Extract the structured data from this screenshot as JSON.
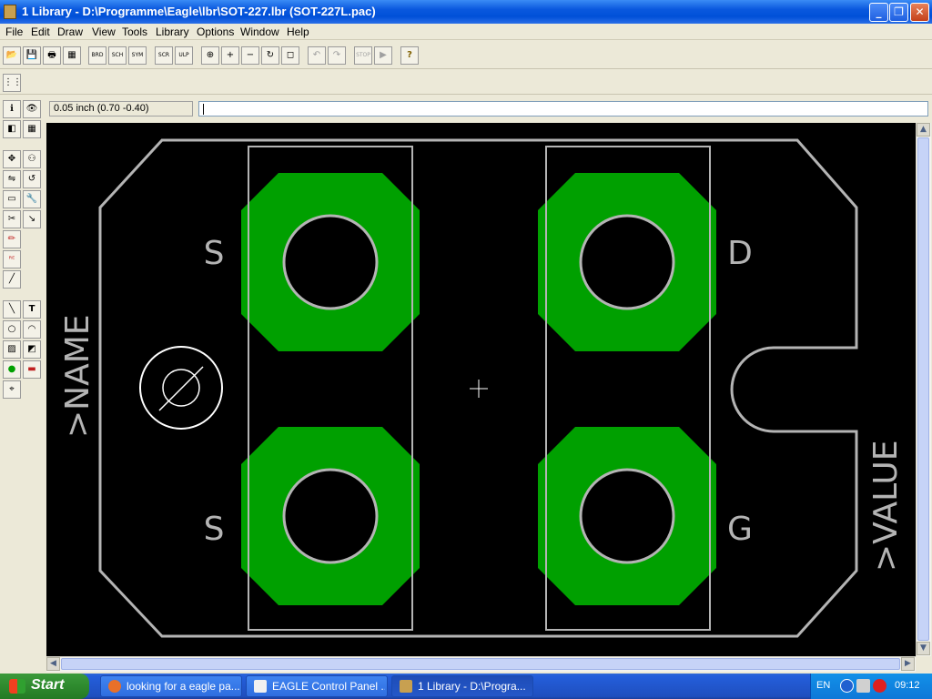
{
  "window": {
    "title": "1 Library - D:\\Programme\\Eagle\\lbr\\SOT-227.lbr (SOT-227L.pac)",
    "minimize": "_",
    "maximize": "❐",
    "close": "✕"
  },
  "menu": [
    "File",
    "Edit",
    "Draw",
    "View",
    "Tools",
    "Library",
    "Options",
    "Window",
    "Help"
  ],
  "toolbar": {
    "open": "📂",
    "save": "💾",
    "print": "🖶",
    "cam": "▦",
    "board": "BRD",
    "schematic": "SCH",
    "symbol": "SYM",
    "script": "SCR",
    "ulp": "ULP",
    "zoom_fit": "⊕",
    "zoom_in": "+",
    "zoom_out": "−",
    "zoom_redraw": "↻",
    "zoom_area": "◻",
    "undo": "↶",
    "redo": "↷",
    "stop": "STOP",
    "go": "▶",
    "help": "?",
    "grid": "⋮⋮"
  },
  "status": {
    "coordinate": "0.05 inch (0.70 -0.40)",
    "command": ""
  },
  "tools": [
    "ℹ",
    "👁",
    "◧",
    "▦",
    "✥",
    "⚇",
    "⇋",
    "↺",
    "▭",
    "🔧",
    "✂",
    "↘",
    "✏",
    "ᴿᴱ",
    "╱",
    "╲",
    "T",
    "○",
    "◠",
    "▨",
    "◩",
    "●",
    "▬",
    "⌖"
  ],
  "package": {
    "pads": [
      {
        "name": "S",
        "pos": "top-left"
      },
      {
        "name": "D",
        "pos": "top-right"
      },
      {
        "name": "S",
        "pos": "bottom-left"
      },
      {
        "name": "G",
        "pos": "bottom-right"
      }
    ],
    "name_label": ">NAME",
    "value_label": ">VALUE",
    "colors": {
      "background": "#000000",
      "pad": "#00a000",
      "outline": "#b4b4b4",
      "drill": "#000000"
    }
  },
  "taskbar": {
    "start": "Start",
    "tasks": [
      {
        "label": "looking for a eagle pa...",
        "icon": "firefox-icon"
      },
      {
        "label": "EAGLE Control Panel ...",
        "icon": "eagle-icon"
      },
      {
        "label": "1 Library - D:\\Progra...",
        "icon": "library-icon"
      }
    ],
    "language": "EN",
    "clock": "09:12"
  }
}
